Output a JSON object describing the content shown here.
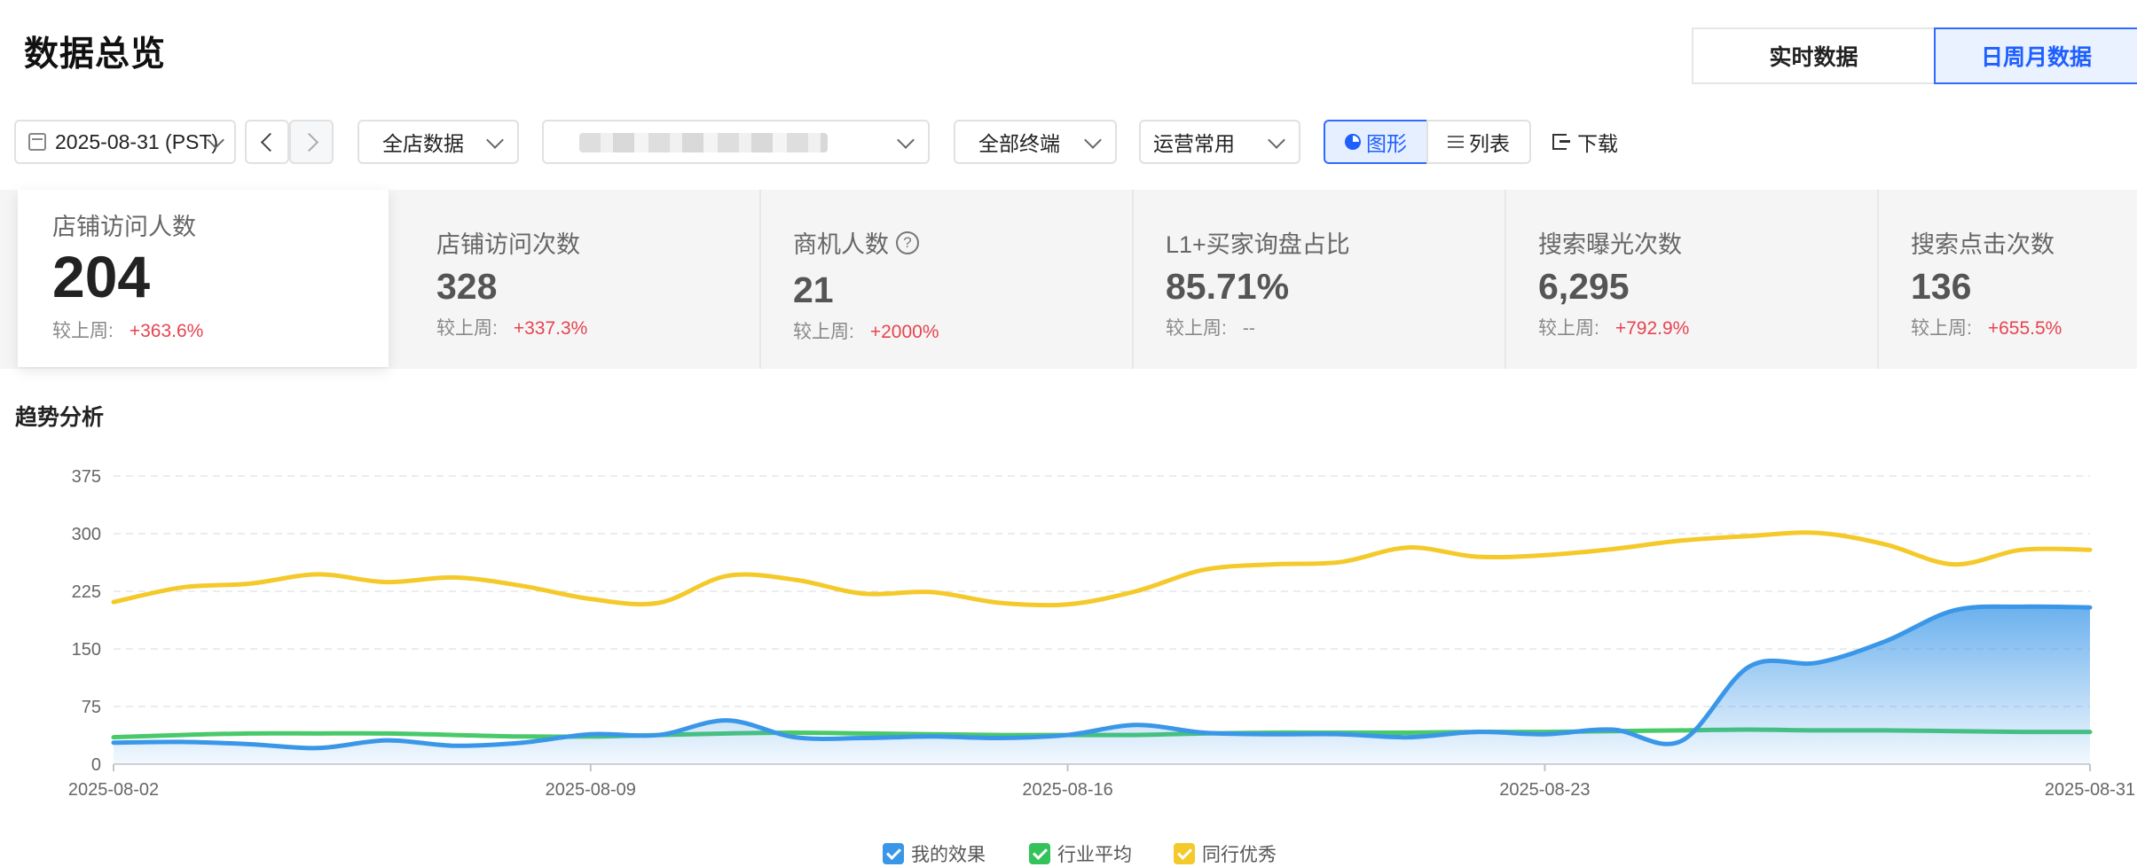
{
  "page": {
    "title": "数据总览"
  },
  "header_tabs": {
    "realtime": "实时数据",
    "period": "日周月数据"
  },
  "filters": {
    "date": "2025-08-31 (PST)",
    "store": "全店数据",
    "product": "",
    "terminal": "全部终端",
    "ops": "运营常用",
    "view_chart": "图形",
    "view_list": "列表",
    "download": "下载"
  },
  "metrics": [
    {
      "label": "店铺访问人数",
      "value": "204",
      "compare_label": "较上周:",
      "change": "+363.6%"
    },
    {
      "label": "店铺访问次数",
      "value": "328",
      "compare_label": "较上周:",
      "change": "+337.3%"
    },
    {
      "label": "商机人数",
      "value": "21",
      "compare_label": "较上周:",
      "change": "+2000%"
    },
    {
      "label": "L1+买家询盘占比",
      "value": "85.71%",
      "compare_label": "较上周:",
      "change": "--"
    },
    {
      "label": "搜索曝光次数",
      "value": "6,295",
      "compare_label": "较上周:",
      "change": "+792.9%"
    },
    {
      "label": "搜索点击次数",
      "value": "136",
      "compare_label": "较上周:",
      "change": "+655.5%"
    }
  ],
  "section": {
    "title": "趋势分析"
  },
  "colors": {
    "mine": "#3a97e8",
    "industry": "#34c35a",
    "peer": "#f4c92a",
    "accent": "#1e5fff",
    "up": "#e6444f"
  },
  "chart_data": {
    "type": "line",
    "x_ticks": [
      "2025-08-02",
      "2025-08-09",
      "2025-08-16",
      "2025-08-23",
      "2025-08-31"
    ],
    "y_ticks": [
      0,
      75,
      150,
      225,
      300,
      375
    ],
    "ylim": [
      0,
      375
    ],
    "grid": true,
    "legend_position": "bottom",
    "x": [
      "2025-08-02",
      "2025-08-03",
      "2025-08-04",
      "2025-08-05",
      "2025-08-06",
      "2025-08-07",
      "2025-08-08",
      "2025-08-09",
      "2025-08-10",
      "2025-08-11",
      "2025-08-12",
      "2025-08-13",
      "2025-08-14",
      "2025-08-15",
      "2025-08-16",
      "2025-08-17",
      "2025-08-18",
      "2025-08-19",
      "2025-08-20",
      "2025-08-21",
      "2025-08-22",
      "2025-08-23",
      "2025-08-24",
      "2025-08-25",
      "2025-08-26",
      "2025-08-27",
      "2025-08-28",
      "2025-08-29",
      "2025-08-30",
      "2025-08-31"
    ],
    "series": [
      {
        "name": "我的效果",
        "fill": true,
        "values": [
          28,
          29,
          26,
          21,
          31,
          24,
          28,
          39,
          38,
          57,
          35,
          34,
          36,
          34,
          38,
          51,
          41,
          39,
          39,
          35,
          42,
          39,
          45,
          30,
          127,
          132,
          160,
          200,
          205,
          204
        ]
      },
      {
        "name": "行业平均",
        "fill": false,
        "values": [
          35,
          38,
          40,
          40,
          40,
          38,
          36,
          36,
          38,
          40,
          41,
          40,
          39,
          38,
          38,
          38,
          40,
          41,
          41,
          41,
          42,
          42,
          43,
          44,
          45,
          44,
          44,
          43,
          42,
          42
        ]
      },
      {
        "name": "同行优秀",
        "fill": false,
        "values": [
          211,
          230,
          235,
          247,
          237,
          243,
          232,
          215,
          210,
          245,
          240,
          222,
          224,
          210,
          208,
          225,
          253,
          260,
          263,
          282,
          270,
          272,
          280,
          291,
          297,
          301,
          286,
          260,
          279,
          279
        ]
      }
    ]
  }
}
